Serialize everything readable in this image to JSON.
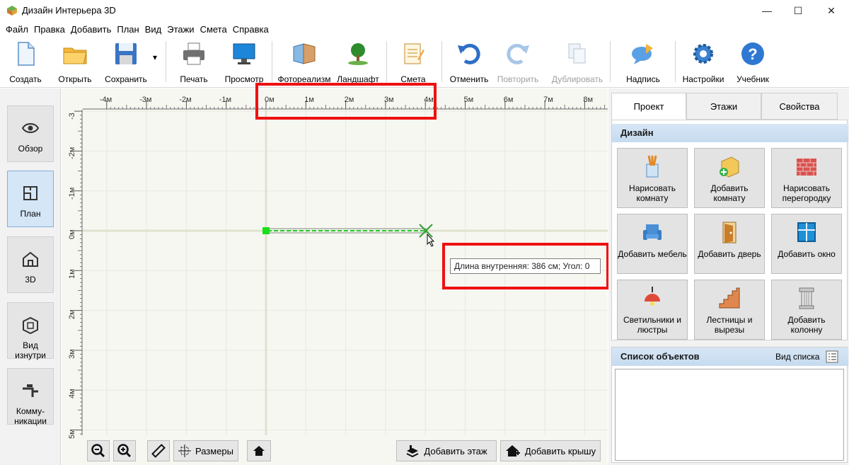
{
  "window": {
    "title": "Дизайн Интерьера 3D",
    "minimize": "—",
    "maximize": "☐",
    "close": "✕"
  },
  "menu": [
    "Файл",
    "Правка",
    "Добавить",
    "План",
    "Вид",
    "Этажи",
    "Смета",
    "Справка"
  ],
  "toolbar": {
    "create": "Создать",
    "open": "Открыть",
    "save": "Сохранить",
    "save_arrow": "▾",
    "print": "Печать",
    "preview": "Просмотр",
    "photo": "Фотореализм",
    "landscape": "Ландшафт",
    "estimate": "Смета",
    "undo": "Отменить",
    "redo": "Повторить",
    "duplicate": "Дублировать",
    "label": "Надпись",
    "settings": "Настройки",
    "tutorial": "Учебник"
  },
  "views": [
    {
      "label": "Обзор",
      "icon": "eye-icon"
    },
    {
      "label": "План",
      "icon": "plan-icon"
    },
    {
      "label": "3D",
      "icon": "house-3d-icon"
    },
    {
      "label": "Вид изнутри",
      "icon": "inside-view-icon"
    },
    {
      "label": "Комму-никации",
      "icon": "pipes-icon"
    }
  ],
  "ruler": {
    "top": [
      "-4м",
      "-3м",
      "-2м",
      "-1м",
      "0м",
      "1м",
      "2м",
      "3м",
      "4м",
      "5м",
      "6м",
      "7м",
      "8м"
    ],
    "left": [
      "-3",
      "-2м",
      "-1м",
      "0м",
      "1м",
      "2м",
      "3м",
      "4м",
      "5м"
    ]
  },
  "wall": {
    "length_cm": 386,
    "angle": 0
  },
  "tooltip": "Длина внутренняя: 386 см; Угол: 0",
  "canvas_buttons": {
    "zoom_out": "zoom-out-icon",
    "zoom_in": "zoom-in-icon",
    "ruler": "ruler-icon",
    "dimensions": "Размеры",
    "home": "home-icon",
    "add_floor": "Добавить этаж",
    "add_roof": "Добавить крышу"
  },
  "right_panel": {
    "tabs": [
      "Проект",
      "Этажи",
      "Свойства"
    ],
    "design_title": "Дизайн",
    "tools": [
      {
        "label": "Нарисовать комнату",
        "icon": "draw-room-icon"
      },
      {
        "label": "Добавить комнату",
        "icon": "add-room-icon"
      },
      {
        "label": "Нарисовать перегородку",
        "icon": "brick-wall-icon"
      },
      {
        "label": "Добавить мебель",
        "icon": "armchair-icon"
      },
      {
        "label": "Добавить дверь",
        "icon": "door-icon"
      },
      {
        "label": "Добавить окно",
        "icon": "window-icon"
      },
      {
        "label": "Светильники и люстры",
        "icon": "lamp-icon"
      },
      {
        "label": "Лестницы и вырезы",
        "icon": "stairs-icon"
      },
      {
        "label": "Добавить колонну",
        "icon": "column-icon"
      }
    ],
    "objlist_title": "Список объектов",
    "list_view_label": "Вид списка"
  },
  "colors": {
    "highlight": "#ee1111",
    "wall": "#33dd33",
    "accent": "#d5e6f7"
  }
}
